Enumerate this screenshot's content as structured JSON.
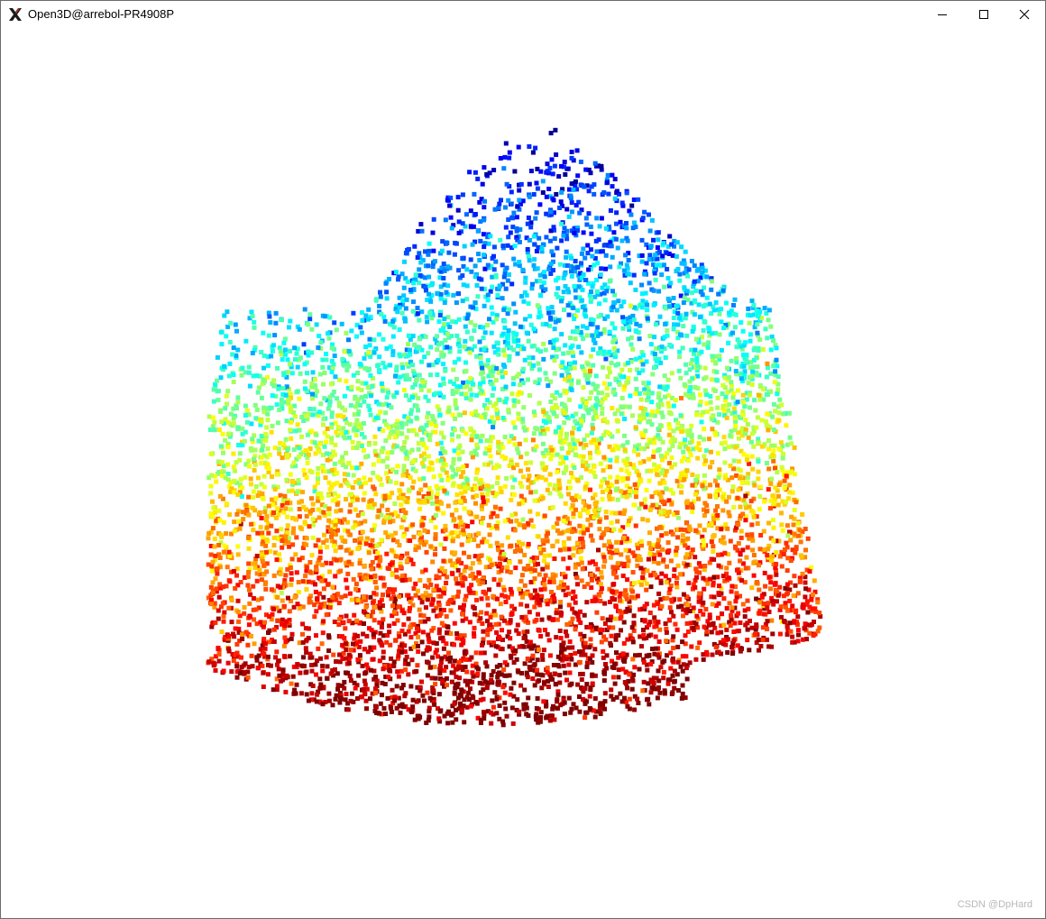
{
  "window": {
    "title": "Open3D@arrebol-PR4908P",
    "app_icon": "x-window-icon",
    "controls": {
      "minimize_icon": "minimize-icon",
      "maximize_icon": "maximize-icon",
      "close_icon": "close-icon"
    }
  },
  "viewer": {
    "background_color": "#ffffff",
    "colormap": "jet",
    "colormap_colors": [
      "#00008f",
      "#0000ff",
      "#00ffff",
      "#ffff00",
      "#ff0000",
      "#800000"
    ]
  },
  "watermark": {
    "text": "CSDN @DpHard"
  }
}
